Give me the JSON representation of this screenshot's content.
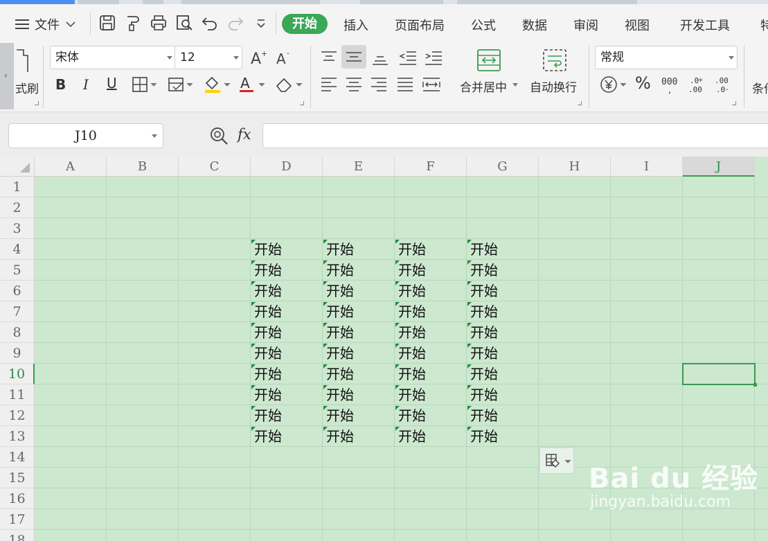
{
  "menubar": {
    "file_label": "文件",
    "tabs": [
      {
        "label": "开始",
        "active": true
      },
      {
        "label": "插入"
      },
      {
        "label": "页面布局"
      },
      {
        "label": "公式"
      },
      {
        "label": "数据"
      },
      {
        "label": "审阅"
      },
      {
        "label": "视图"
      },
      {
        "label": "开发工具"
      },
      {
        "label": "特"
      }
    ],
    "quick_icons": [
      "save-icon",
      "format-painter-icon",
      "print-icon",
      "print-preview-icon",
      "undo-icon",
      "redo-icon",
      "customize-icon"
    ]
  },
  "ribbon": {
    "format_painter_label": "式刷",
    "font_name": "宋体",
    "font_size": "12",
    "merge_center_label": "合并居中",
    "wrap_text_label": "自动换行",
    "number_format": "常规",
    "conditional_label": "条件",
    "font_color": "#e02020",
    "fill_color": "#ffd200"
  },
  "formula_bar": {
    "cell_ref": "J10",
    "fx_label": "fx",
    "formula_value": ""
  },
  "sheet": {
    "columns": [
      "A",
      "B",
      "C",
      "D",
      "E",
      "F",
      "G",
      "H",
      "I",
      "J"
    ],
    "rows": [
      "1",
      "2",
      "3",
      "4",
      "5",
      "6",
      "7",
      "8",
      "9",
      "10",
      "11",
      "12",
      "13",
      "14",
      "15",
      "16",
      "17",
      "18"
    ],
    "selected_cell": "J10",
    "data": [
      [
        "开始",
        "开始",
        "开始",
        "开始"
      ],
      [
        "开始",
        "开始",
        "开始",
        "开始"
      ],
      [
        "开始",
        "开始",
        "开始",
        "开始"
      ],
      [
        "开始",
        "开始",
        "开始",
        "开始"
      ],
      [
        "开始",
        "开始",
        "开始",
        "开始"
      ],
      [
        "开始",
        "开始",
        "开始",
        "开始"
      ],
      [
        "开始",
        "开始",
        "开始",
        "开始"
      ],
      [
        "开始",
        "开始",
        "开始",
        "开始"
      ],
      [
        "开始",
        "开始",
        "开始",
        "开始"
      ],
      [
        "开始",
        "开始",
        "开始",
        "开始"
      ]
    ],
    "data_start_row": 4,
    "data_start_col": "D",
    "grid_bg": "#cce8cf",
    "accent": "#3a9a4f"
  },
  "watermark": {
    "line1": "Bai du 经验",
    "line2": "jingyan.baidu.com"
  }
}
